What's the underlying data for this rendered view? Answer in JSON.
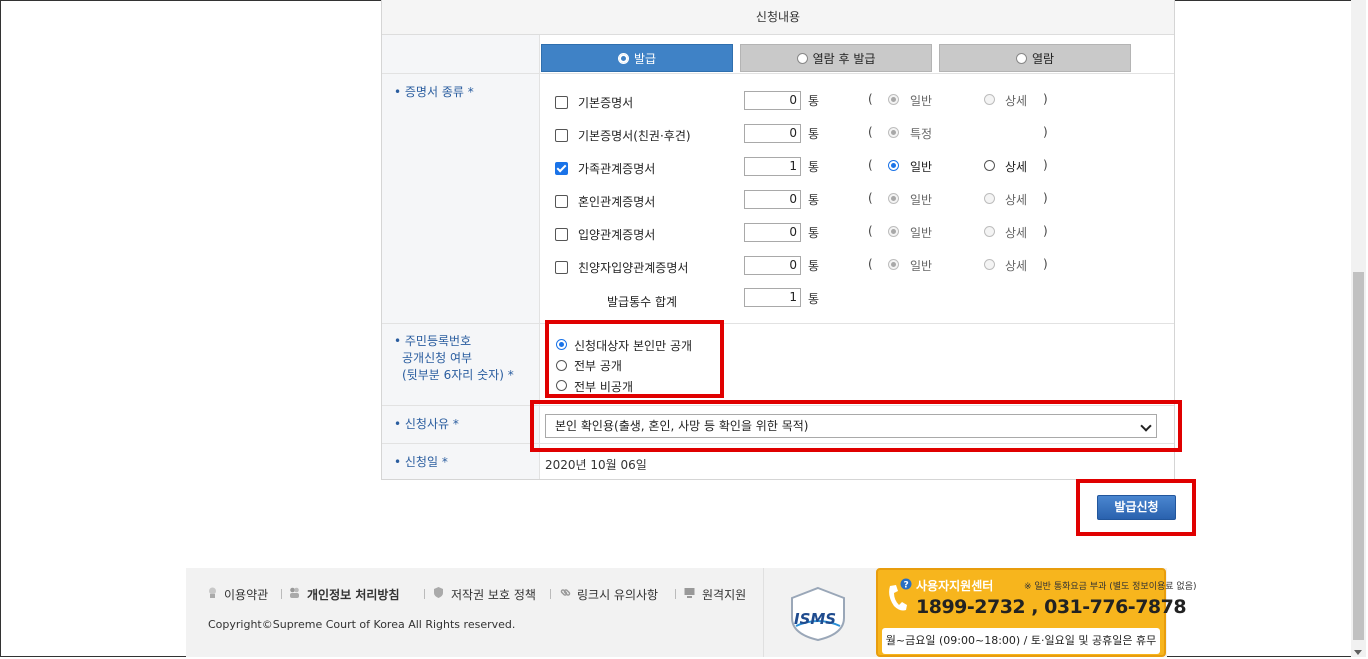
{
  "section_title": "신청내용",
  "tabs": [
    {
      "label": "발급",
      "active": true
    },
    {
      "label": "열람 후 발급",
      "active": false
    },
    {
      "label": "열람",
      "active": false
    }
  ],
  "labels": {
    "cert_type": "• 증명서 종류 *",
    "rrn_line1": "• 주민등록번호",
    "rrn_line2": "공개신청 여부",
    "rrn_line3": "(뒷부분 6자리 숫자) *",
    "reason": "• 신청사유 *",
    "date": "• 신청일 *"
  },
  "certificates": [
    {
      "name": "기본증명서",
      "checked": false,
      "qty": "0",
      "unit": "통",
      "open": "(",
      "close": ")",
      "opt1": "일반",
      "opt2": "상세",
      "opt1_state": "disabled-sel",
      "opt2_state": "disabled"
    },
    {
      "name": "기본증명서(친권·후견)",
      "checked": false,
      "qty": "0",
      "unit": "통",
      "open": "(",
      "close": ")",
      "opt1": "특정",
      "opt2": "",
      "opt1_state": "disabled-sel",
      "opt2_state": "none"
    },
    {
      "name": "가족관계증명서",
      "checked": true,
      "qty": "1",
      "unit": "통",
      "open": "(",
      "close": ")",
      "opt1": "일반",
      "opt2": "상세",
      "opt1_state": "enabled-sel",
      "opt2_state": "enabled"
    },
    {
      "name": "혼인관계증명서",
      "checked": false,
      "qty": "0",
      "unit": "통",
      "open": "(",
      "close": ")",
      "opt1": "일반",
      "opt2": "상세",
      "opt1_state": "disabled-sel",
      "opt2_state": "disabled"
    },
    {
      "name": "입양관계증명서",
      "checked": false,
      "qty": "0",
      "unit": "통",
      "open": "(",
      "close": ")",
      "opt1": "일반",
      "opt2": "상세",
      "opt1_state": "disabled-sel",
      "opt2_state": "disabled"
    },
    {
      "name": "친양자입양관계증명서",
      "checked": false,
      "qty": "0",
      "unit": "통",
      "open": "(",
      "close": ")",
      "opt1": "일반",
      "opt2": "상세",
      "opt1_state": "disabled-sel",
      "opt2_state": "disabled"
    }
  ],
  "total": {
    "label": "발급통수 합계",
    "qty": "1",
    "unit": "통"
  },
  "rrn_options": [
    {
      "label": "신청대상자 본인만 공개",
      "selected": true
    },
    {
      "label": "전부 공개",
      "selected": false
    },
    {
      "label": "전부 비공개",
      "selected": false
    }
  ],
  "reason_select": {
    "value": "본인 확인용(출생, 혼인, 사망 등 확인을 위한 목적)"
  },
  "apply_date": "2020년 10월 06일",
  "submit_label": "발급신청",
  "footer": {
    "links": [
      "이용약관",
      "개인정보 처리방침",
      "저작권 보호 정책",
      "링크시 유의사항",
      "원격지원"
    ],
    "copyright": "Copyright©Supreme Court of Korea All Rights reserved.",
    "isms": "ISMS",
    "call_title": "사용자지원센터",
    "call_note": "※ 일반 통화요금 부과 (별도 정보이용료 없음)",
    "call_phone": "1899-2732 , 031-776-7878",
    "call_hours": "월~금요일 (09:00~18:00) / 토·일요일 및 공휴일은 휴무"
  },
  "colors": {
    "accent": "#3f82c6",
    "highlight": "#e00000",
    "label": "#2a5d9f",
    "callcenter": "#f7b51d"
  }
}
